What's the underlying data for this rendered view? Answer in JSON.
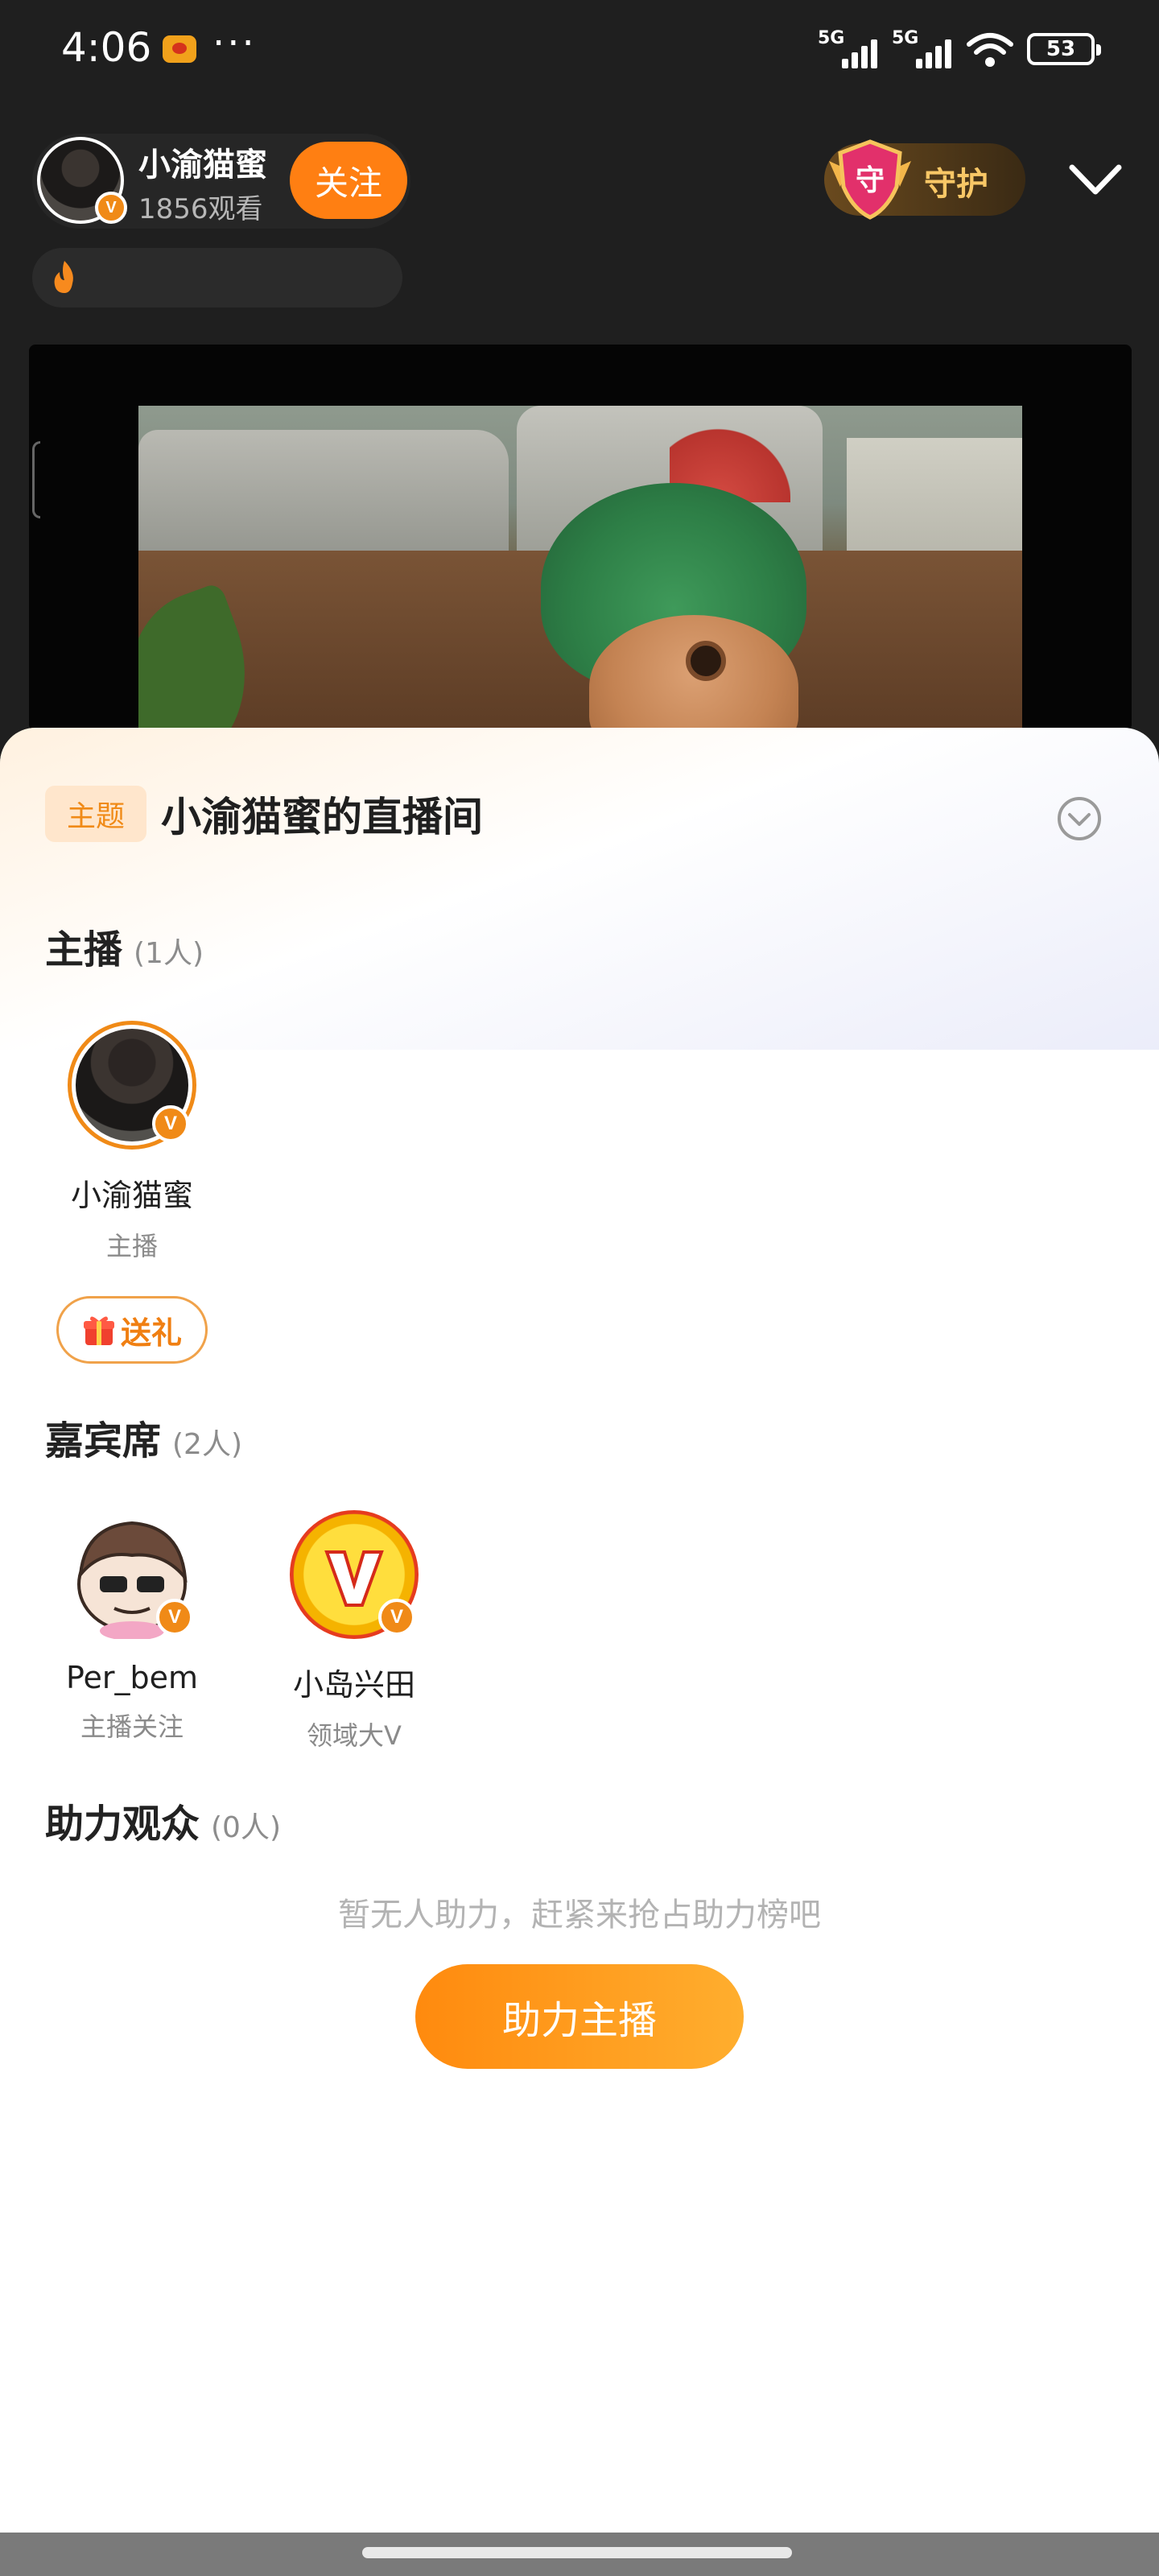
{
  "status_bar": {
    "time": "4:06",
    "more": "···",
    "signal1_label": "5G",
    "signal2_label": "5G",
    "battery": "53"
  },
  "host": {
    "name": "小渝猫蜜",
    "viewers": "1856观看",
    "follow_label": "关注",
    "verified_badge": "V",
    "guard_label": "守护",
    "guard_shield_char": "守"
  },
  "sheet": {
    "topic_tag": "主题",
    "room_title": "小渝猫蜜的直播间",
    "anchor_section": {
      "title": "主播",
      "count": "(1人)",
      "members": [
        {
          "name": "小渝猫蜜",
          "role": "主播"
        }
      ],
      "gift_label": "送礼"
    },
    "guest_section": {
      "title": "嘉宾席",
      "count": "(2人)",
      "members": [
        {
          "name": "Per_bem",
          "role": "主播关注"
        },
        {
          "name": "小岛兴田",
          "role": "领域大V"
        }
      ]
    },
    "boost_section": {
      "title": "助力观众",
      "count": "(0人)",
      "empty_hint": "暂无人助力，赶紧来抢占助力榜吧",
      "boost_button": "助力主播"
    }
  },
  "colors": {
    "accent_orange": "#ff7f12",
    "dark_bg": "#1f1f1f",
    "sheet_bg": "#ffffff",
    "muted_text": "#8a8a8a"
  }
}
